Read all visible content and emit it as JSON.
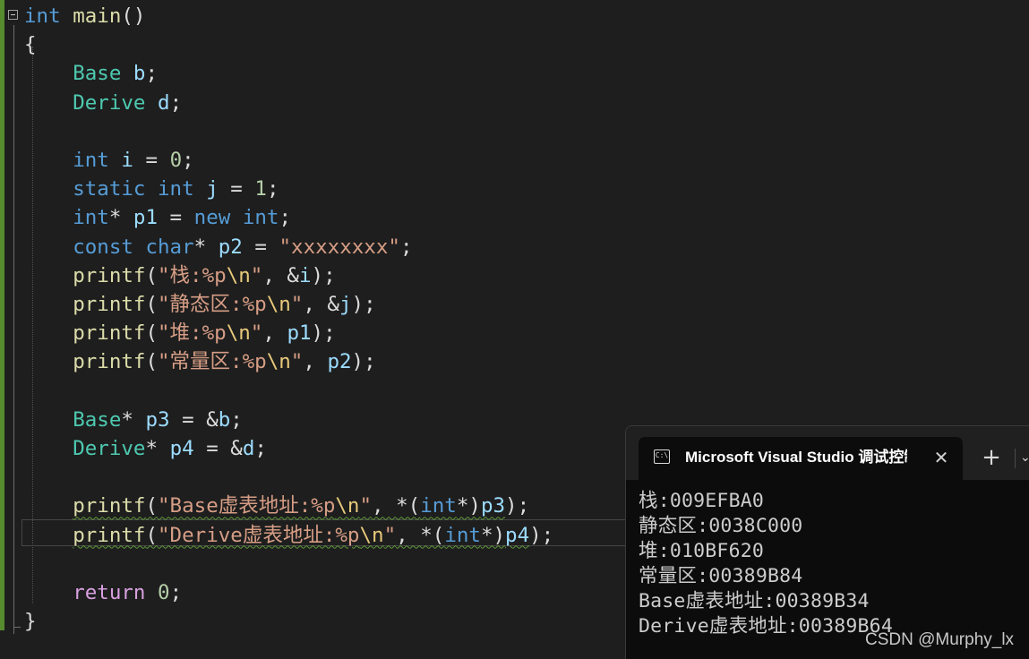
{
  "editor": {
    "fold_marker": "⊟",
    "lines": [
      [
        {
          "t": "int",
          "c": "kw"
        },
        {
          "t": " "
        },
        {
          "t": "main",
          "c": "fn"
        },
        {
          "t": "()"
        }
      ],
      [
        {
          "t": "{"
        }
      ],
      [
        {
          "t": "    "
        },
        {
          "t": "Base",
          "c": "ty"
        },
        {
          "t": " "
        },
        {
          "t": "b",
          "c": "id"
        },
        {
          "t": ";"
        }
      ],
      [
        {
          "t": "    "
        },
        {
          "t": "Derive",
          "c": "ty"
        },
        {
          "t": " "
        },
        {
          "t": "d",
          "c": "id"
        },
        {
          "t": ";"
        }
      ],
      [],
      [
        {
          "t": "    "
        },
        {
          "t": "int",
          "c": "kw"
        },
        {
          "t": " "
        },
        {
          "t": "i",
          "c": "id"
        },
        {
          "t": " = "
        },
        {
          "t": "0",
          "c": "num"
        },
        {
          "t": ";"
        }
      ],
      [
        {
          "t": "    "
        },
        {
          "t": "static",
          "c": "kw"
        },
        {
          "t": " "
        },
        {
          "t": "int",
          "c": "kw"
        },
        {
          "t": " "
        },
        {
          "t": "j",
          "c": "id"
        },
        {
          "t": " = "
        },
        {
          "t": "1",
          "c": "num"
        },
        {
          "t": ";"
        }
      ],
      [
        {
          "t": "    "
        },
        {
          "t": "int",
          "c": "kw"
        },
        {
          "t": "* "
        },
        {
          "t": "p1",
          "c": "id"
        },
        {
          "t": " = "
        },
        {
          "t": "new",
          "c": "kw"
        },
        {
          "t": " "
        },
        {
          "t": "int",
          "c": "kw"
        },
        {
          "t": ";"
        }
      ],
      [
        {
          "t": "    "
        },
        {
          "t": "const",
          "c": "kw"
        },
        {
          "t": " "
        },
        {
          "t": "char",
          "c": "kw"
        },
        {
          "t": "* "
        },
        {
          "t": "p2",
          "c": "id"
        },
        {
          "t": " = "
        },
        {
          "t": "\"xxxxxxxx\"",
          "c": "str"
        },
        {
          "t": ";"
        }
      ],
      [
        {
          "t": "    "
        },
        {
          "t": "printf",
          "c": "fn"
        },
        {
          "t": "("
        },
        {
          "t": "\"栈:%p",
          "c": "str"
        },
        {
          "t": "\\n",
          "c": "esc"
        },
        {
          "t": "\"",
          "c": "str"
        },
        {
          "t": ", &"
        },
        {
          "t": "i",
          "c": "id"
        },
        {
          "t": ");"
        }
      ],
      [
        {
          "t": "    "
        },
        {
          "t": "printf",
          "c": "fn"
        },
        {
          "t": "("
        },
        {
          "t": "\"静态区:%p",
          "c": "str"
        },
        {
          "t": "\\n",
          "c": "esc"
        },
        {
          "t": "\"",
          "c": "str"
        },
        {
          "t": ", &"
        },
        {
          "t": "j",
          "c": "id"
        },
        {
          "t": ");"
        }
      ],
      [
        {
          "t": "    "
        },
        {
          "t": "printf",
          "c": "fn"
        },
        {
          "t": "("
        },
        {
          "t": "\"堆:%p",
          "c": "str"
        },
        {
          "t": "\\n",
          "c": "esc"
        },
        {
          "t": "\"",
          "c": "str"
        },
        {
          "t": ", "
        },
        {
          "t": "p1",
          "c": "id"
        },
        {
          "t": ");"
        }
      ],
      [
        {
          "t": "    "
        },
        {
          "t": "printf",
          "c": "fn"
        },
        {
          "t": "("
        },
        {
          "t": "\"常量区:%p",
          "c": "str"
        },
        {
          "t": "\\n",
          "c": "esc"
        },
        {
          "t": "\"",
          "c": "str"
        },
        {
          "t": ", "
        },
        {
          "t": "p2",
          "c": "id"
        },
        {
          "t": ");"
        }
      ],
      [],
      [
        {
          "t": "    "
        },
        {
          "t": "Base",
          "c": "ty"
        },
        {
          "t": "* "
        },
        {
          "t": "p3",
          "c": "id"
        },
        {
          "t": " = &"
        },
        {
          "t": "b",
          "c": "id"
        },
        {
          "t": ";"
        }
      ],
      [
        {
          "t": "    "
        },
        {
          "t": "Derive",
          "c": "ty"
        },
        {
          "t": "* "
        },
        {
          "t": "p4",
          "c": "id"
        },
        {
          "t": " = &"
        },
        {
          "t": "d",
          "c": "id"
        },
        {
          "t": ";"
        }
      ],
      [],
      [
        {
          "t": "    "
        },
        {
          "t": "printf",
          "c": "fn",
          "s": 1
        },
        {
          "t": "(",
          "s": 1
        },
        {
          "t": "\"Base虚表地址:%p",
          "c": "str",
          "s": 1
        },
        {
          "t": "\\n",
          "c": "esc",
          "s": 1
        },
        {
          "t": "\"",
          "c": "str",
          "s": 1
        },
        {
          "t": ", *(",
          "s": 1
        },
        {
          "t": "int",
          "c": "kw",
          "s": 1
        },
        {
          "t": "*)",
          "s": 1
        },
        {
          "t": "p3",
          "c": "id",
          "s": 1
        },
        {
          "t": ");"
        }
      ],
      [
        {
          "t": "    "
        },
        {
          "t": "printf",
          "c": "fn",
          "s": 1
        },
        {
          "t": "(",
          "s": 1
        },
        {
          "t": "\"Derive虚表地址:%p",
          "c": "str",
          "s": 1
        },
        {
          "t": "\\n",
          "c": "esc",
          "s": 1
        },
        {
          "t": "\"",
          "c": "str",
          "s": 1
        },
        {
          "t": ", *(",
          "s": 1
        },
        {
          "t": "int",
          "c": "kw",
          "s": 1
        },
        {
          "t": "*)",
          "s": 1
        },
        {
          "t": "p4",
          "c": "id",
          "s": 1
        },
        {
          "t": ");"
        }
      ],
      [],
      [
        {
          "t": "    "
        },
        {
          "t": "return",
          "c": "ctl"
        },
        {
          "t": " "
        },
        {
          "t": "0",
          "c": "num"
        },
        {
          "t": ";"
        }
      ],
      [
        {
          "t": "}"
        }
      ]
    ]
  },
  "terminal": {
    "tab_title": "Microsoft Visual Studio 调试控制台",
    "tab_icon": "C:\\",
    "close_glyph": "✕",
    "add_glyph": "+",
    "dropdown_glyph": "⌄",
    "output": [
      "栈:009EFBA0",
      "静态区:0038C000",
      "堆:010BF620",
      "常量区:00389B84",
      "Base虚表地址:00389B34",
      "Derive虚表地址:00389B64"
    ]
  },
  "watermark": "CSDN @Murphy_lx",
  "icons": {
    "terminal_tab": "console-icon",
    "close": "close-icon",
    "new_tab": "plus-icon",
    "dropdown": "chevron-down-icon",
    "fold": "collapse-icon"
  }
}
